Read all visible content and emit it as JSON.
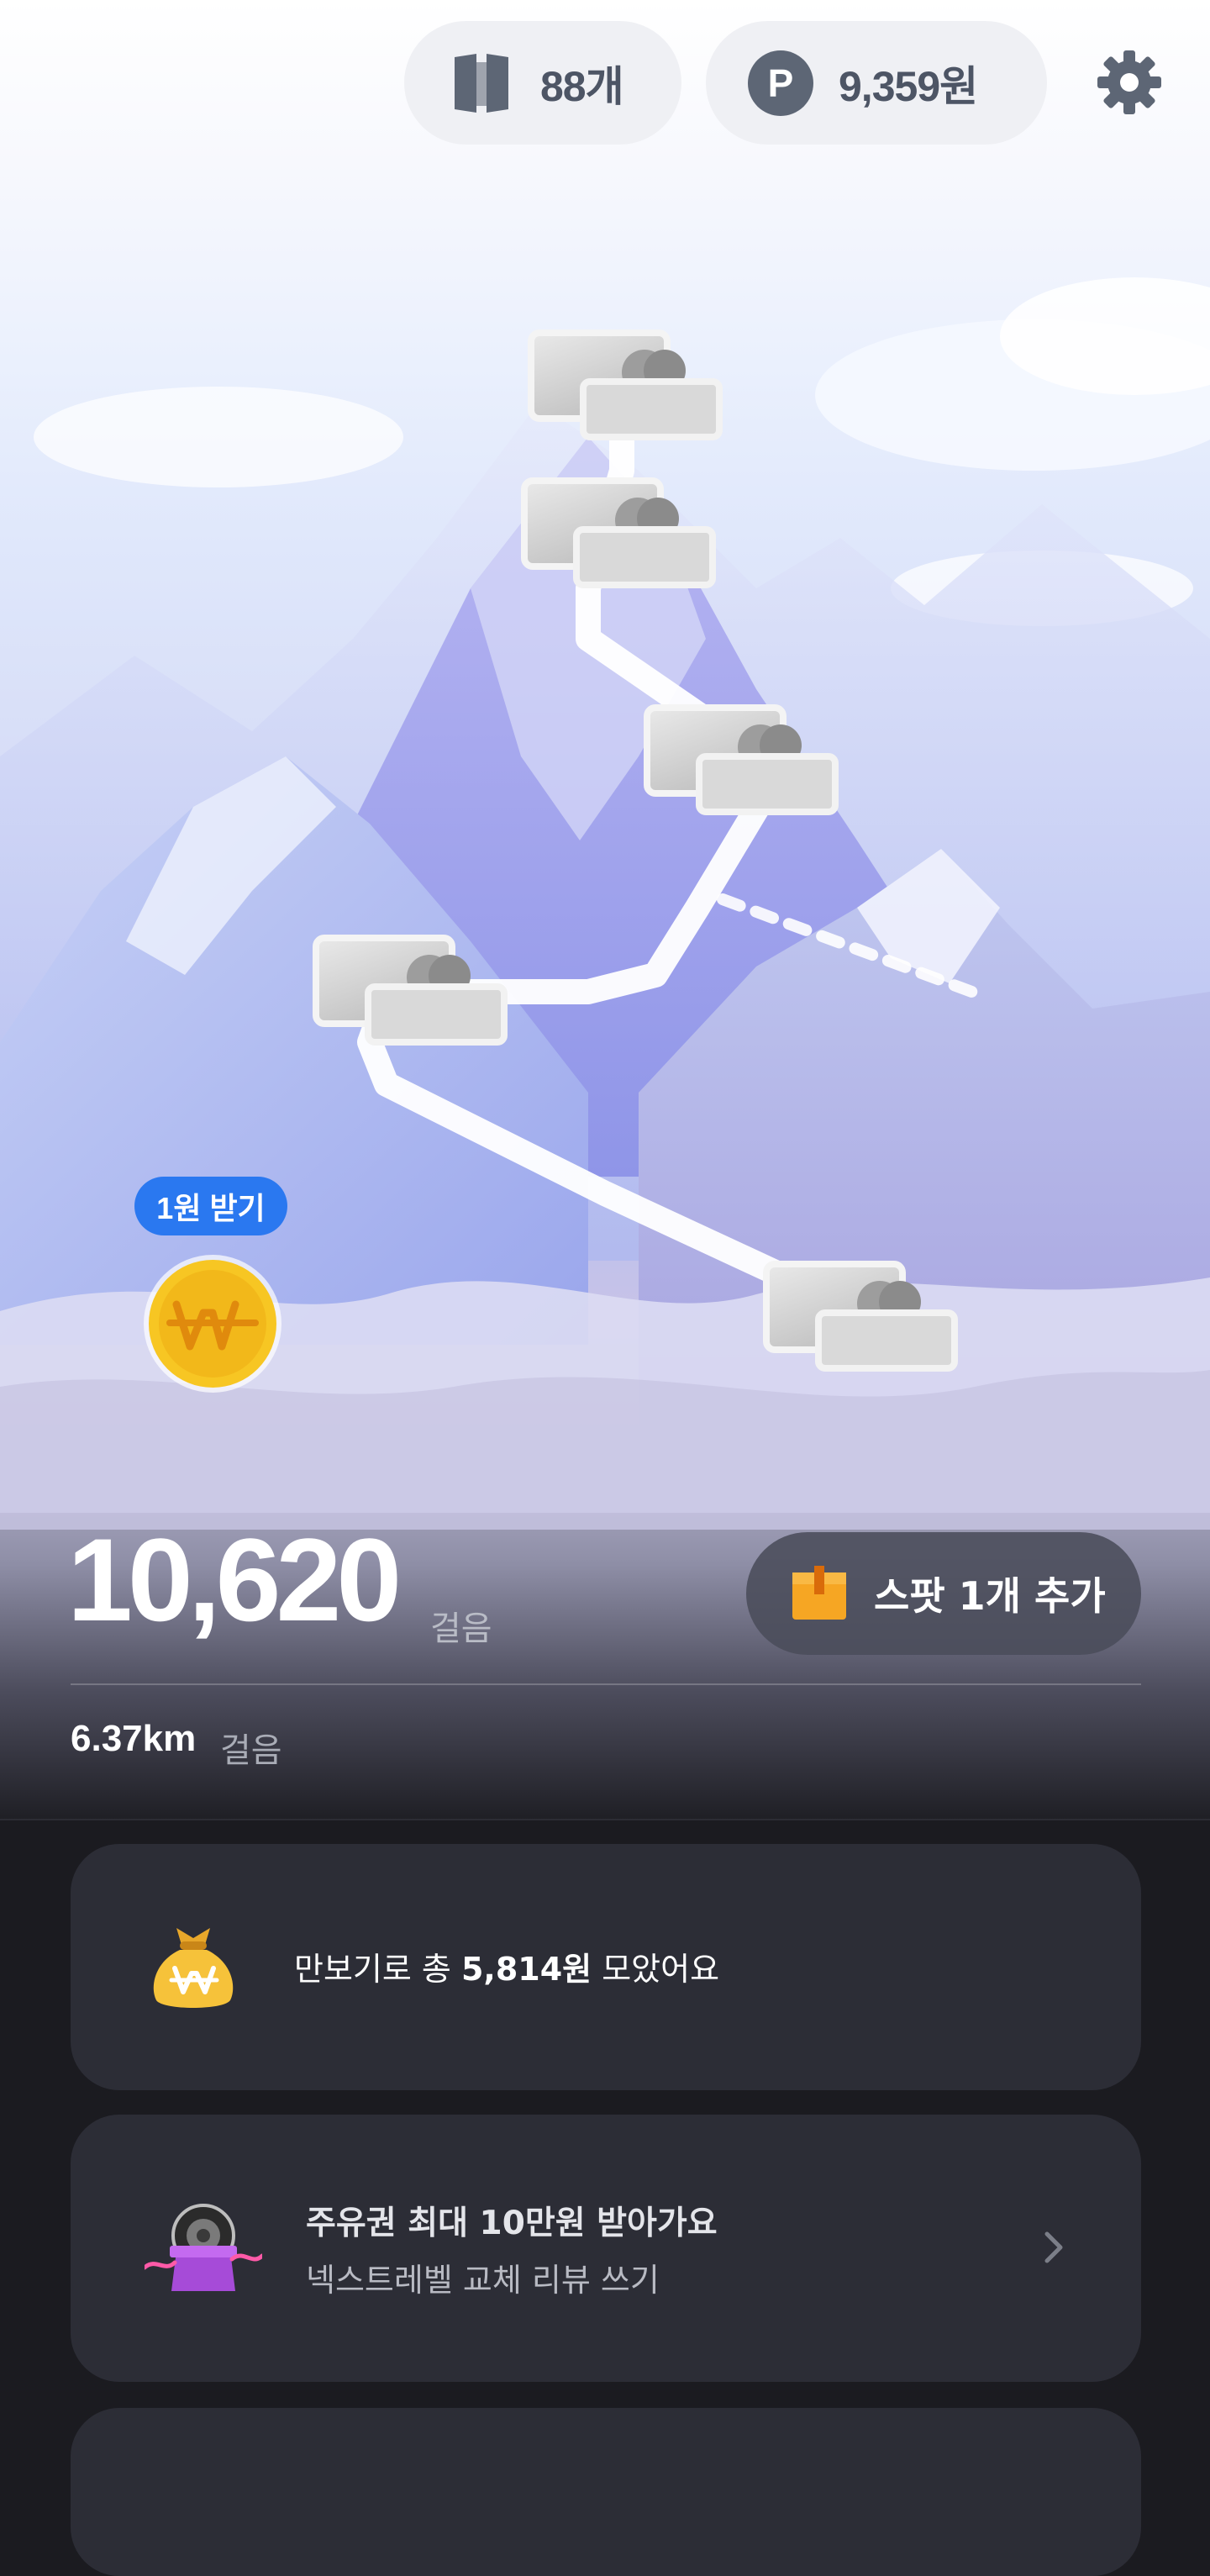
{
  "header": {
    "tickets": "88개",
    "points": "9,359원",
    "points_icon_letter": "P",
    "icons": [
      "ticket-icon",
      "point-icon",
      "gear-icon"
    ]
  },
  "map": {
    "spot_count": 5,
    "coin": {
      "badge": "1원 받기",
      "icon": "won-coin-icon"
    }
  },
  "steps": {
    "count": "10,620",
    "unit": "걸음",
    "distance": "6.37km",
    "distance_unit": "걸음",
    "add_spot_label": "스팟 1개 추가"
  },
  "cards": {
    "savings": {
      "prefix": "만보기로 총 ",
      "amount": "5,814원",
      "suffix": " 모았어요",
      "icon": "money-bag-icon"
    },
    "promo": {
      "title": "주유권 최대 10만원 받아가요",
      "subtitle": "넥스트레벨 교체 리뷰 쓰기",
      "icon": "tire-gift-icon"
    }
  },
  "colors": {
    "accent_blue": "#2a78f0",
    "coin_gold": "#f4c21a",
    "card_bg": "#2c2d36",
    "page_bg": "#1b1b20"
  }
}
